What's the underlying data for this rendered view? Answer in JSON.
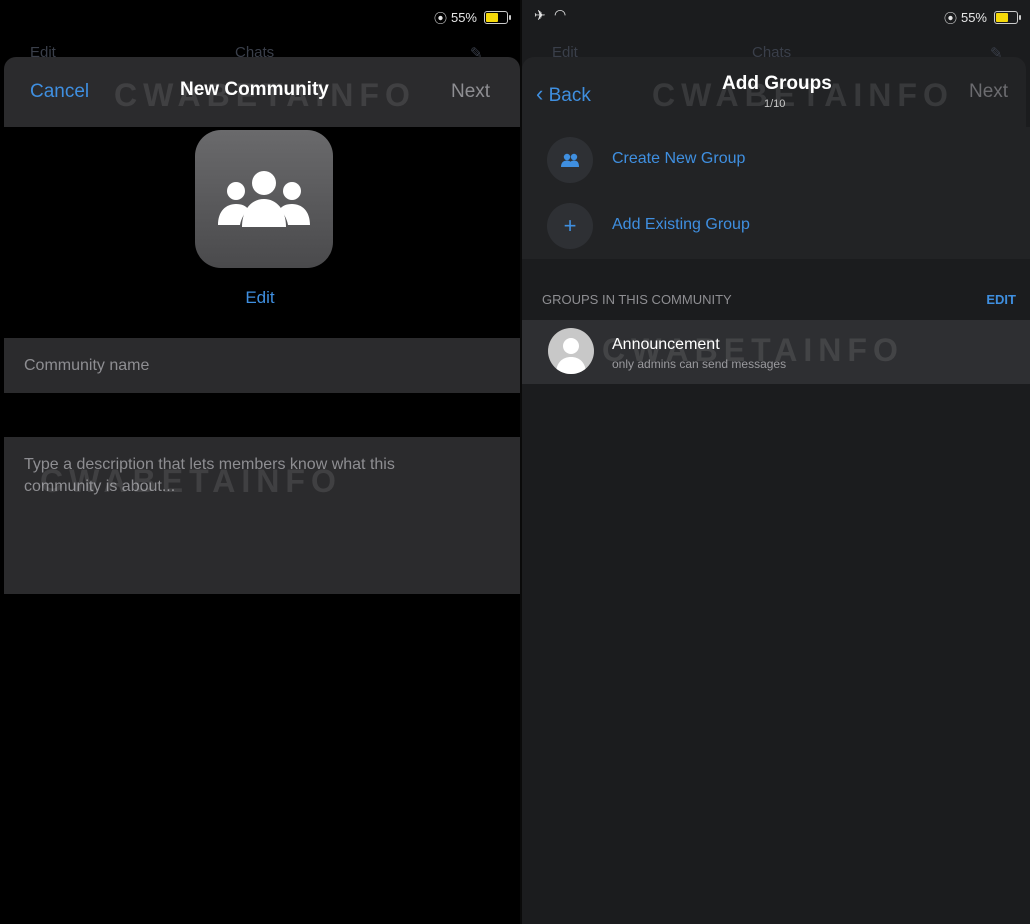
{
  "left": {
    "status": {
      "battery": "55%"
    },
    "under_header": {
      "edit": "Edit",
      "title": "Chats"
    },
    "nav": {
      "cancel": "Cancel",
      "title": "New Community",
      "next": "Next"
    },
    "watermark": "CWABETAINFO",
    "avatar_icon": "community-icon",
    "edit_photo": "Edit",
    "name_placeholder": "Community name",
    "description_placeholder": "Type a description that lets members know what this community is about..."
  },
  "right": {
    "status": {
      "battery": "55%"
    },
    "under_header": {
      "edit": "Edit",
      "title": "Chats"
    },
    "nav": {
      "back": "Back",
      "title": "Add Groups",
      "subtitle": "1/10",
      "next": "Next"
    },
    "watermark": "CWABETAINFO",
    "actions": [
      {
        "label": "Create New Group",
        "icon": "people-icon"
      },
      {
        "label": "Add Existing Group",
        "icon": "plus-icon"
      }
    ],
    "section_header": "GROUPS IN THIS COMMUNITY",
    "section_edit": "EDIT",
    "group": {
      "name": "Announcement",
      "subtitle": "only admins can send messages"
    }
  },
  "colors": {
    "accent": "#3f8fe0",
    "battery": "#f5d90a",
    "sheet": "#2b2b2d",
    "background": "#000000"
  }
}
